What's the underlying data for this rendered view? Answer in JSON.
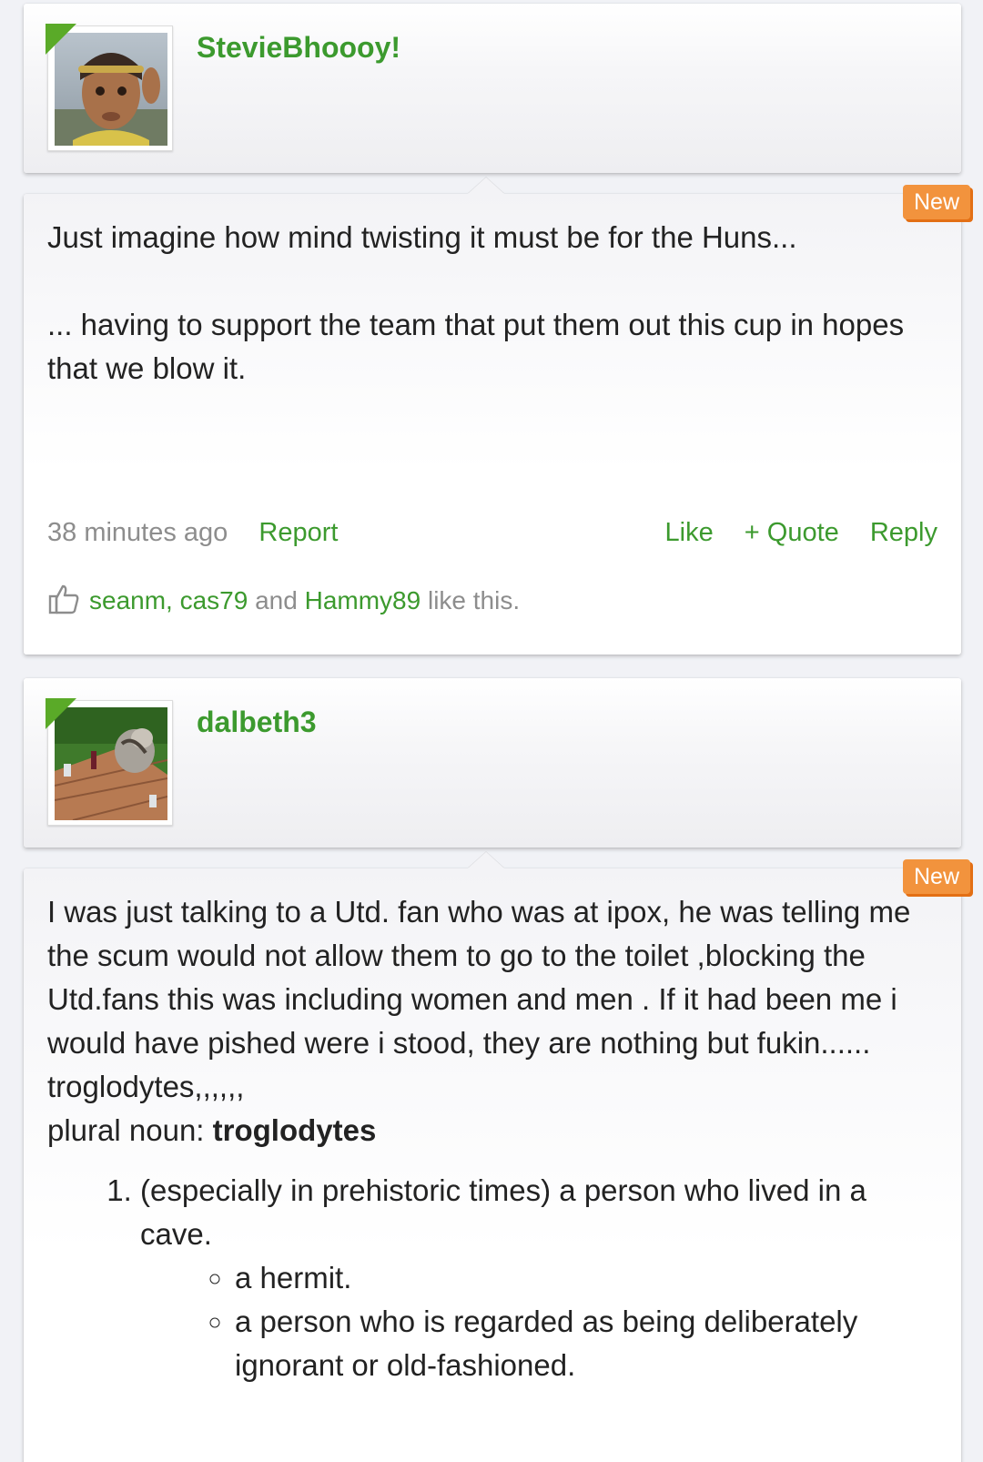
{
  "posts": [
    {
      "username": "StevieBhoooy!",
      "badge": "New",
      "paragraphs": [
        "Just imagine how mind twisting it must be for the Huns...",
        "... having to support the team that put them out this cup in hopes that we blow it."
      ],
      "timestamp": "38 minutes ago",
      "report_label": "Report",
      "like_label": "Like",
      "quote_label": "+ Quote",
      "reply_label": "Reply",
      "likes": {
        "users": [
          "seanm",
          "cas79",
          "Hammy89"
        ],
        "sep_comma": ",",
        "and_text": "and",
        "suffix": "like this."
      }
    },
    {
      "username": "dalbeth3",
      "badge": "New",
      "body": "I was just talking to a Utd. fan who was at ipox, he was telling me the scum would not allow them to go to the toilet ,blocking the Utd.fans this was including women and men . If it had been me i would have pished were i stood, they are nothing but fukin...... troglodytes,,,,,,",
      "plural_label": "plural noun:",
      "plural_word": "troglodytes",
      "definition": "(especially in prehistoric times) a person who lived in a cave.",
      "sub_definitions": [
        "a hermit.",
        "a person who is regarded as being deliberately ignorant or old-fashioned."
      ]
    }
  ],
  "icons": {
    "online_indicator": "online-corner-icon",
    "like_icon": "thumbs-up-icon"
  },
  "colors": {
    "link_green": "#3c9a2e",
    "badge_orange": "#f2933d",
    "online_green": "#5aaa28",
    "muted_gray": "#8d8d8d"
  }
}
